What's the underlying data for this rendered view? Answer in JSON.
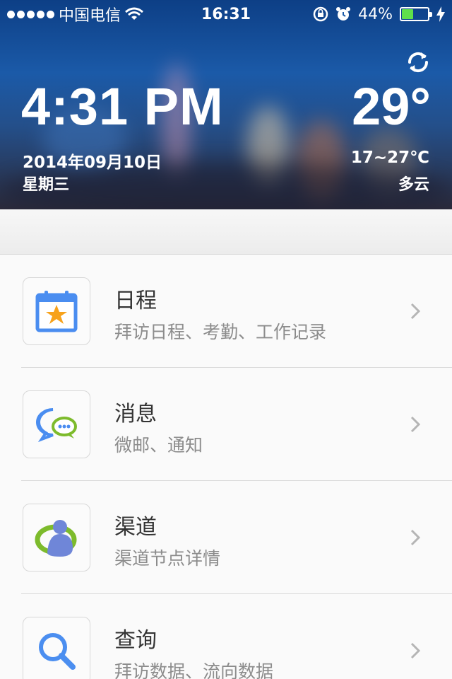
{
  "status_bar": {
    "carrier": "中国电信",
    "time": "16:31",
    "battery_percent": "44%",
    "battery_level": 0.44,
    "icons": [
      "signal-dots-icon",
      "wifi-icon",
      "rotation-lock-icon",
      "alarm-icon",
      "battery-icon",
      "charging-icon"
    ]
  },
  "header": {
    "clock": "4:31 PM",
    "date": "2014年09月10日",
    "weekday": "星期三",
    "temperature": "29°",
    "temp_range": "17~27℃",
    "condition": "多云",
    "refresh_icon": "refresh-icon"
  },
  "colors": {
    "header_blue": "#1b5aa8",
    "calendar_blue": "#4a8df0",
    "star_orange": "#f7a21b",
    "message_green": "#7dbb2c",
    "channel_purple": "#6f86d8",
    "search_blue": "#4b8ef0"
  },
  "menu": [
    {
      "title": "日程",
      "subtitle": "拜访日程、考勤、工作记录",
      "icon": "calendar-star-icon"
    },
    {
      "title": "消息",
      "subtitle": "微邮、通知",
      "icon": "chat-bubbles-icon"
    },
    {
      "title": "渠道",
      "subtitle": "渠道节点详情",
      "icon": "channel-person-icon"
    },
    {
      "title": "查询",
      "subtitle": "拜访数据、流向数据",
      "icon": "search-icon"
    }
  ]
}
